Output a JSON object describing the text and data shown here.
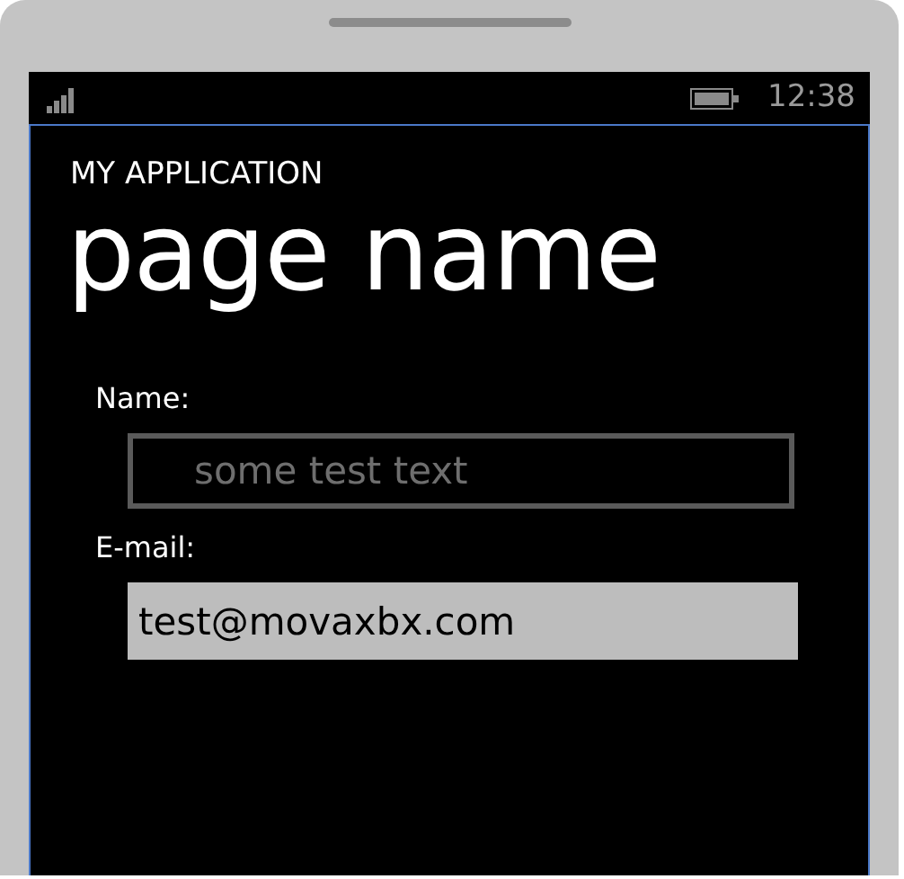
{
  "status_bar": {
    "time": "12:38"
  },
  "app_title": "MY APPLICATION",
  "page_title": "page name",
  "fields": [
    {
      "label": "Name:",
      "placeholder": "some test text",
      "focused": false
    },
    {
      "label": "E-mail:",
      "value": "test@movaxbx.com",
      "focused": true
    }
  ]
}
